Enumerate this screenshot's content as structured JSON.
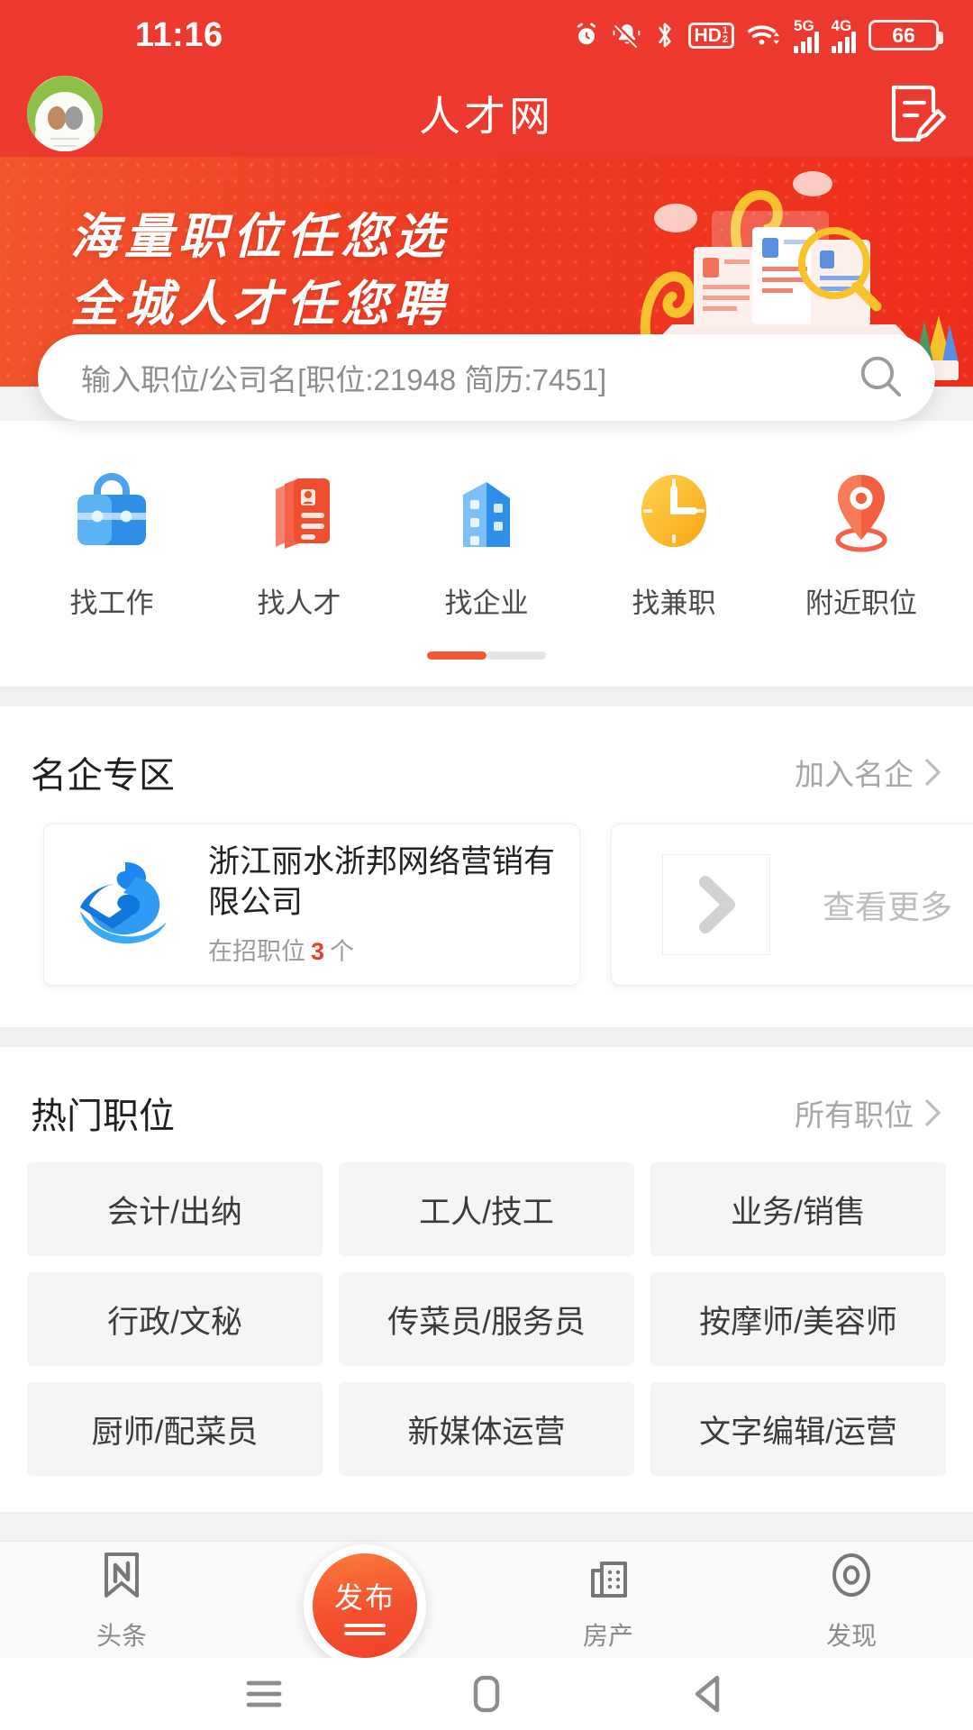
{
  "status_bar": {
    "time": "11:16",
    "battery_percent": "66",
    "network_5g": "5G",
    "network_4g": "4G",
    "hd_label": "HD",
    "hd_sub_top": "1",
    "hd_sub_bottom": "2",
    "icons": [
      "alarm-icon",
      "mute-icon",
      "bluetooth-icon",
      "volte-hd-icon",
      "wifi-icon",
      "signal-5g-icon",
      "signal-4g-icon",
      "battery-icon"
    ]
  },
  "header": {
    "title": "人才网",
    "avatar_name": "user-avatar",
    "edit_icon": "resume-edit-icon",
    "brand_color": "#EE3A2E"
  },
  "banner": {
    "line1": "海量职位任您选",
    "line2": "全城人才任您聘"
  },
  "search": {
    "placeholder": "输入职位/公司名[职位:21948 简历:7451]",
    "value": "",
    "icon": "search-icon"
  },
  "quick_entries": [
    {
      "label": "找工作",
      "icon": "briefcase-icon"
    },
    {
      "label": "找人才",
      "icon": "resume-cards-icon"
    },
    {
      "label": "找企业",
      "icon": "buildings-icon"
    },
    {
      "label": "找兼职",
      "icon": "clock-icon"
    },
    {
      "label": "附近职位",
      "icon": "location-pin-icon"
    }
  ],
  "carousel": {
    "pages": 2,
    "active": 1
  },
  "famous_companies": {
    "title": "名企专区",
    "more_label": "加入名企",
    "cards": [
      {
        "name": "浙江丽水浙邦网络营销有限公司",
        "jobs_prefix": "在招职位",
        "jobs_count": "3",
        "jobs_suffix": "个",
        "logo": "company-logo-icon"
      }
    ],
    "view_more_label": "查看更多",
    "view_more_icon": "chevron-right-icon"
  },
  "hot_jobs": {
    "title": "热门职位",
    "more_label": "所有职位",
    "tags": [
      "会计/出纳",
      "工人/技工",
      "业务/销售",
      "行政/文秘",
      "传菜员/服务员",
      "按摩师/美容师",
      "厨师/配菜员",
      "新媒体运营",
      "文字编辑/运营"
    ]
  },
  "tabbar": {
    "items": [
      {
        "label": "头条",
        "icon": "bookmark-n-icon"
      },
      {
        "label": "房产",
        "icon": "building-icon"
      },
      {
        "label": "发现",
        "icon": "eye-icon"
      }
    ],
    "fab": {
      "label": "发布",
      "icon": "publish-icon",
      "color": "#F4502E"
    }
  },
  "android_nav": {
    "items": [
      {
        "icon": "menu-icon"
      },
      {
        "icon": "home-icon"
      },
      {
        "icon": "back-icon"
      }
    ]
  }
}
